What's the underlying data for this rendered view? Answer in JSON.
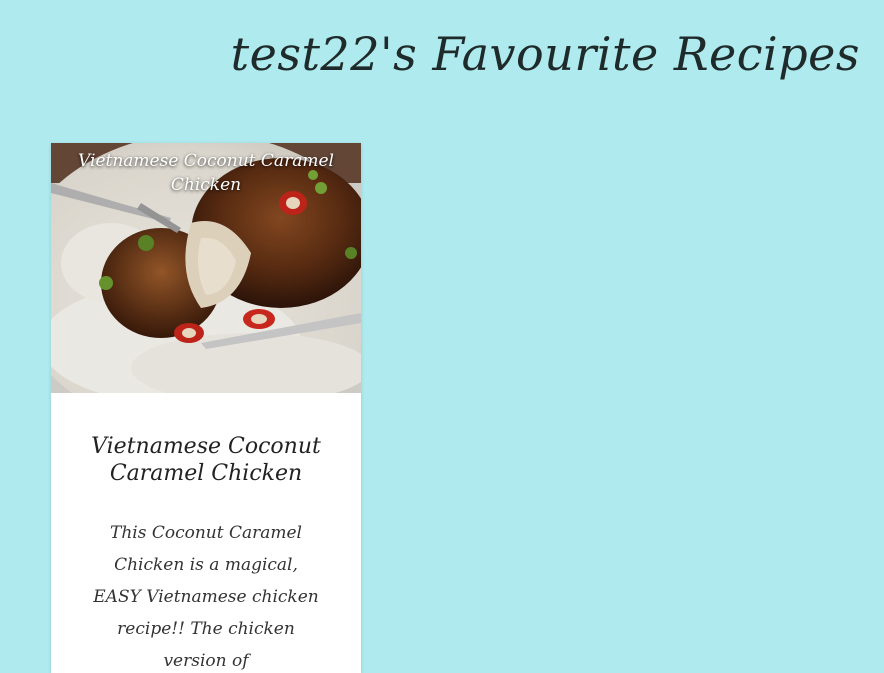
{
  "page": {
    "title": "test22's Favourite Recipes"
  },
  "recipes": [
    {
      "image_caption": "Vietnamese Coconut Caramel Chicken",
      "title": "Vietnamese Coconut Caramel Chicken",
      "description": "This Coconut Caramel Chicken is a magical, EASY Vietnamese chicken recipe!! The chicken version of"
    }
  ],
  "colors": {
    "background": "#aeeaee",
    "card": "#ffffff",
    "text_dark": "#1f2a2a"
  }
}
